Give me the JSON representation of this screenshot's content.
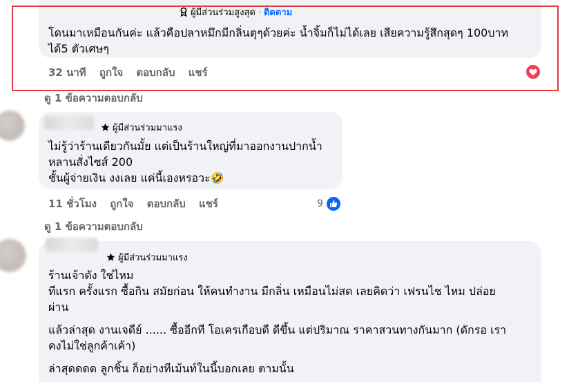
{
  "comment1": {
    "badge": "ผู้มีส่วนร่วมสูงสุด",
    "follow": "ติดตาม",
    "lines": [
      "โดนมาเหมือนกันค่ะ แล้วคือปลาหมึกมีกลิ่นตุๆด้วยค่ะ น้ำจิ้มก็ไม่ได้เลย เสียความรู้สึกสุดๆ 100บาท",
      "ได้5 ตัวเศษๆ"
    ],
    "time": "32 นาที",
    "like": "ถูกใจ",
    "reply": "ตอบกลับ",
    "share": "แชร์",
    "reaction_icon": "heart-icon",
    "reaction_color": "#f33e58"
  },
  "replies1": "ดู 1 ข้อความตอบกลับ",
  "comment2": {
    "badge": "ผู้มีส่วนร่วมมาแรง",
    "lines": [
      "ไม่รู้ว่าร้านเดียวกันมั้ย แต่เป็นร้านใหญ่ที่มาออกงานปากน้ำ",
      "หลานสั่งไซส์ 200",
      "ชั้นผู้จ่ายเงิน งงเลย แค่นี้เองหรอวะ"
    ],
    "emoji": "🤣",
    "time": "11 ชั่วโมง",
    "like": "ถูกใจ",
    "reply": "ตอบกลับ",
    "share": "แชร์",
    "reaction_count": "9",
    "reaction_icon": "thumbs-up-icon",
    "reaction_color": "#0866ff"
  },
  "replies2": "ดู 1 ข้อความตอบกลับ",
  "comment3": {
    "badge": "ผู้มีส่วนร่วมมาแรง",
    "lines": [
      "ร้านเจ้าดัง ใช่ไหม",
      "ทีแรก ครั้งแรก ซื้อกิน สมัยก่อน ให้คนทำงาน มีกลิ่น เหมือนไม่สด เลยคิดว่า เฟรนไช ไหม ปล่อย",
      "ผ่าน",
      "แล้วล่าสุด งานเจดีย์ ...... ซื้ออีกที โอเครเกือบดี ดีขึ้น แต่ปริมาณ ราคาสวนทางกันมาก (ดักรอ เรา",
      "คงไม่ใช่ลูกค้าเค้า)",
      "ล่าสุดดดด ลูกชิ้น ก็อย่างทีเม้นท์ในนี้บอกเลย ตามนั้น"
    ]
  },
  "colors": {
    "highlight": "#e0393e",
    "bubble": "#f0f2f5",
    "link": "#0866ff",
    "meta": "#65676b"
  }
}
